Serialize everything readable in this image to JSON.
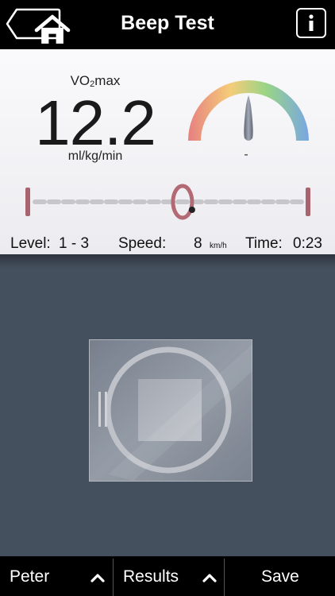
{
  "header": {
    "title": "Beep Test",
    "home_icon": "home-icon",
    "info_icon": "info-icon"
  },
  "readout": {
    "vo2_label_main": "VO",
    "vo2_label_sub": "2",
    "vo2_label_tail": "max",
    "vo2_value": "12.2",
    "vo2_unit": "ml/kg/min",
    "gauge_reading": "-",
    "gauge_colors": [
      "#e57373",
      "#f4c86a",
      "#8fd07a",
      "#6a9ee0"
    ]
  },
  "progress": {
    "position_fraction": 0.55
  },
  "stats": {
    "level_label": "Level:",
    "level_value": "1 - 3",
    "speed_label": "Speed:",
    "speed_value": "8",
    "speed_unit": "km/h",
    "time_label": "Time:",
    "time_value": "0:23"
  },
  "control": {
    "icon": "stop-icon"
  },
  "bottom_bar": {
    "athlete_label": "Peter",
    "results_label": "Results",
    "save_label": "Save"
  }
}
